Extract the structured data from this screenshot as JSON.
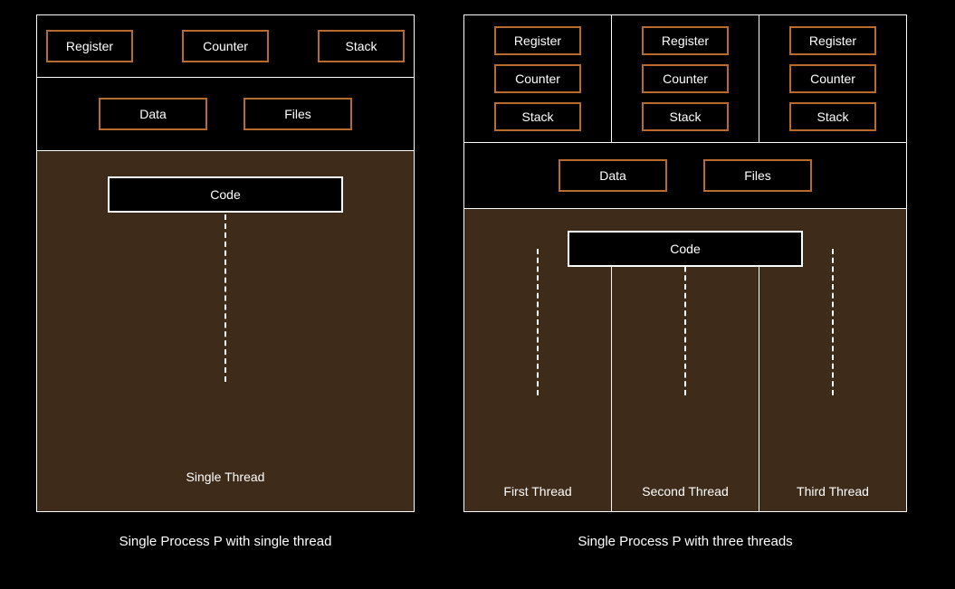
{
  "left": {
    "top": {
      "register": "Register",
      "counter": "Counter",
      "stack": "Stack"
    },
    "mid": {
      "data": "Data",
      "files": "Files"
    },
    "code": "Code",
    "thread_label": "Single Thread",
    "caption": "Single Process P with single thread"
  },
  "right": {
    "cols": [
      {
        "register": "Register",
        "counter": "Counter",
        "stack": "Stack"
      },
      {
        "register": "Register",
        "counter": "Counter",
        "stack": "Stack"
      },
      {
        "register": "Register",
        "counter": "Counter",
        "stack": "Stack"
      }
    ],
    "mid": {
      "data": "Data",
      "files": "Files"
    },
    "code": "Code",
    "threads": [
      "First Thread",
      "Second Thread",
      "Third Thread"
    ],
    "caption": "Single Process P with three threads"
  }
}
